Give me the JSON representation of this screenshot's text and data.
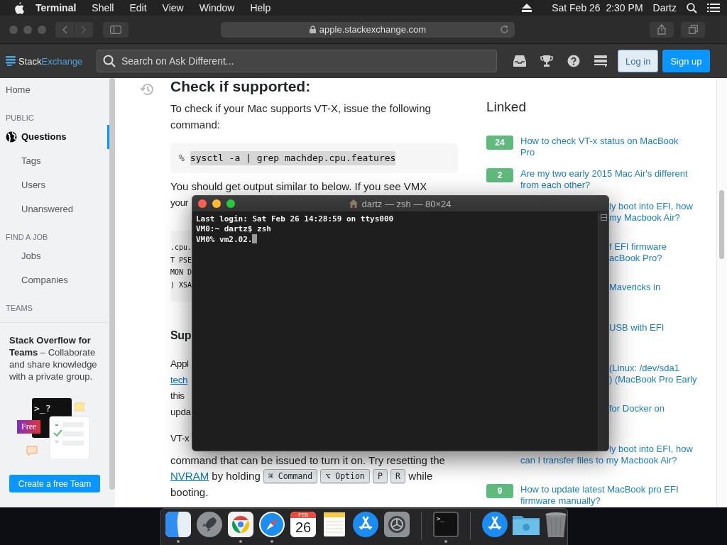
{
  "menubar": {
    "app": "Terminal",
    "menus": [
      "Shell",
      "Edit",
      "View",
      "Window",
      "Help"
    ],
    "clock": "Sat Feb 26  2:30 PM",
    "user": "Dartz"
  },
  "browser": {
    "url": "apple.stackexchange.com"
  },
  "site_header": {
    "logo": [
      "Stack",
      "Exchange"
    ],
    "search": {
      "placeholder": "Search on Ask Different..."
    },
    "buttons": [
      {
        "label": "Log in",
        "kind": "secondary"
      },
      {
        "label": "Sign up",
        "kind": "primary"
      }
    ]
  },
  "sidebar": {
    "items": [
      {
        "kind": "link",
        "label": "Home",
        "selected": false
      },
      {
        "kind": "heading",
        "label": "PUBLIC"
      },
      {
        "kind": "globe-link",
        "label": "Questions",
        "selected": true
      },
      {
        "kind": "sub-link",
        "label": "Tags",
        "selected": false
      },
      {
        "kind": "sub-link",
        "label": "Users",
        "selected": false
      },
      {
        "kind": "sub-link",
        "label": "Unanswered",
        "selected": false
      },
      {
        "kind": "heading",
        "label": "FIND A JOB"
      },
      {
        "kind": "sub-link",
        "label": "Jobs",
        "selected": false
      },
      {
        "kind": "sub-link",
        "label": "Companies",
        "selected": false
      },
      {
        "kind": "heading",
        "label": "TEAMS"
      }
    ],
    "teams": {
      "text": "**Stack Overflow for Teams** – Collaborate and share knowledge with a private group.",
      "prompt": ">_?",
      "badge": "Free",
      "button": "Create a free Team"
    }
  },
  "post": {
    "heading": "Check if supported:",
    "intro": "To check if your Mac supports VT-X, issue the following command:",
    "code": {
      "prompt": "%",
      "command": "sysctl -a | grep machdep.cpu.features",
      "selected": true
    },
    "output_intro": "You should get output similar to below. If you see VMX",
    "output_intro_tail": "your",
    "output_lines": [
      ".cpu.",
      "T PSE",
      "MON D",
      ") XSA"
    ],
    "heading_2": "Sup",
    "fragments": [
      {
        "kind": "text",
        "text": "Appl"
      },
      {
        "kind": "link",
        "text": "tech"
      },
      {
        "kind": "text",
        "text": "this"
      },
      {
        "kind": "text",
        "text": "upda"
      }
    ],
    "fragment_2": "VT-x",
    "closing": [
      [
        {
          "kind": "text",
          "text": "command that can be issued to turn it on. Try resetting the"
        }
      ],
      [
        {
          "kind": "link",
          "text": "NVRAM"
        },
        {
          "kind": "text",
          "text": "by holding"
        },
        {
          "kind": "key",
          "text": "⌘ Command"
        },
        {
          "kind": "key",
          "text": "⌥ Option"
        },
        {
          "kind": "key",
          "text": "P"
        },
        {
          "kind": "key",
          "text": "R"
        },
        {
          "kind": "text",
          "text": "while"
        }
      ],
      [
        {
          "kind": "text",
          "text": "booting."
        }
      ]
    ]
  },
  "linked": {
    "title": "Linked",
    "items": [
      {
        "votes": "24",
        "lines": [
          {
            "text": "How to check VT-x status on MacBook",
            "kind": "whole"
          },
          {
            "text": "Pro",
            "kind": "whole"
          }
        ]
      },
      {
        "votes": "2",
        "lines": [
          {
            "text": "Are my two early 2015 Mac Air's different",
            "kind": "whole"
          },
          {
            "text": "from each other?",
            "kind": "whole"
          }
        ]
      },
      {
        "lines": [
          {
            "text": "ly boot into EFI, how",
            "kind": "cut"
          },
          {
            "text": "my Macbook Air?",
            "kind": "cut"
          }
        ]
      },
      {
        "lines": [
          {
            "text": "f EFI firmware",
            "kind": "cut"
          },
          {
            "text": "acBook Pro?",
            "kind": "cut"
          }
        ]
      },
      {
        "lines": [
          {
            "text": "Mavericks in",
            "kind": "cut"
          }
        ]
      },
      {
        "lines": [
          {
            "text": "USB with EFI",
            "kind": "cut"
          }
        ]
      },
      {
        "lines": [
          {
            "text": "(Linux: /dev/sda1",
            "kind": "cut"
          },
          {
            "text": ") (MacBook Pro Early",
            "kind": "cut"
          }
        ]
      },
      {
        "lines": [
          {
            "text": "for Docker on",
            "kind": "cut"
          }
        ]
      },
      {
        "lines": [
          {
            "text": "ly boot into EFI, how",
            "kind": "cut"
          },
          {
            "text": "can I transfer files to my Macbook Air?",
            "kind": "whole"
          }
        ]
      },
      {
        "votes": "9",
        "lines": [
          {
            "text": "How to update latest MacBook pro EFI",
            "kind": "whole"
          },
          {
            "text": "firmware manually?",
            "kind": "whole"
          }
        ]
      }
    ]
  },
  "terminal": {
    "title": "dartz — zsh — 80×24",
    "lines": [
      "Last login: Sat Feb 26 14:28:59 on ttys000",
      "VM0:~ dartz$ zsh",
      "VM0% vm2.02."
    ],
    "cursor": true
  },
  "dock": {
    "items": [
      {
        "kind": "finder",
        "running": true
      },
      {
        "kind": "launchpad",
        "running": false
      },
      {
        "kind": "chrome",
        "running": true
      },
      {
        "kind": "safari",
        "running": true
      },
      {
        "kind": "calendar",
        "month": "FEB",
        "day": "26",
        "running": false
      },
      {
        "kind": "notes",
        "running": false
      },
      {
        "kind": "app-store",
        "running": false
      },
      {
        "kind": "settings",
        "running": false
      },
      {
        "kind": "separator"
      },
      {
        "kind": "terminal",
        "prompt": ">_",
        "running": true
      },
      {
        "kind": "separator"
      },
      {
        "kind": "app-store",
        "running": false
      },
      {
        "kind": "downloads",
        "running": false
      },
      {
        "kind": "trash",
        "running": false
      }
    ]
  }
}
